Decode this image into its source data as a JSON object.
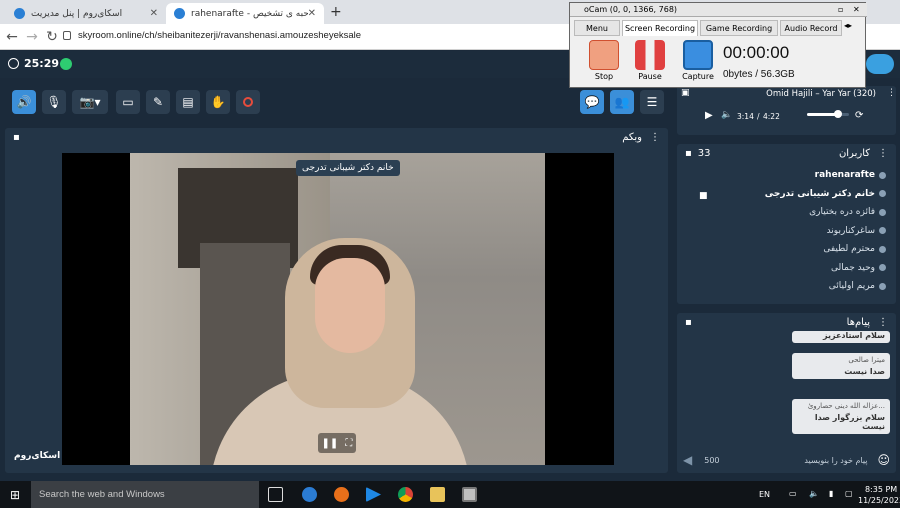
{
  "browser": {
    "tabs": [
      {
        "title": "اسکای‌روم | پنل مدیریت"
      },
      {
        "title": "rahenarafte - مصاحبه ی تشخیص"
      }
    ],
    "url": "skyroom.online/ch/sheibanitezerji/ravanshenasi.amouzesheyeksale"
  },
  "app": {
    "timer": "25:29",
    "webcam_title": "وبکم",
    "speaker_name": "خانم دکتر شیبانی تدرجی",
    "watermark": "اسکای‌روم"
  },
  "music": {
    "track": "Omid Hajili – Yar Yar (320)",
    "current": "3:14",
    "separator": "/",
    "total": "4:22",
    "progress": 0.74
  },
  "users": {
    "title": "کاربران",
    "count": "33",
    "list": [
      {
        "name": "rahenarafte",
        "bold": true
      },
      {
        "name": "خانم دکتر شیبانی تدرجی",
        "bold": true
      },
      {
        "name": "فائزه دره بختیاری",
        "bold": false
      },
      {
        "name": "ساغرکناربوند",
        "bold": false
      },
      {
        "name": "محترم لطیفی",
        "bold": false
      },
      {
        "name": "وحید جمالی",
        "bold": false
      },
      {
        "name": "مریم اولیائی",
        "bold": false
      }
    ]
  },
  "messages": {
    "title": "پیام‌ها",
    "items": [
      {
        "who": "",
        "text": "سلام استادعزیز"
      },
      {
        "who": "میترا صالحی",
        "text": "صدا نیست"
      },
      {
        "who": "عزاله الله دینی حصاروئ...",
        "text": "سلام بزرگوار صدا نیست"
      }
    ],
    "placeholder": "پیام خود را بنویسید",
    "counter": "500"
  },
  "ocam": {
    "title": "oCam (0, 0, 1366, 768)",
    "tabs": [
      "Menu",
      "Screen Recording",
      "Game Recording",
      "Audio Record"
    ],
    "buttons": [
      "Stop",
      "Pause",
      "Capture"
    ],
    "time": "00:00:00",
    "size": "0bytes / 56.3GB"
  },
  "taskbar": {
    "search": "Search the web and Windows",
    "lang": "EN",
    "time": "8:35 PM",
    "date": "11/25/2023"
  }
}
